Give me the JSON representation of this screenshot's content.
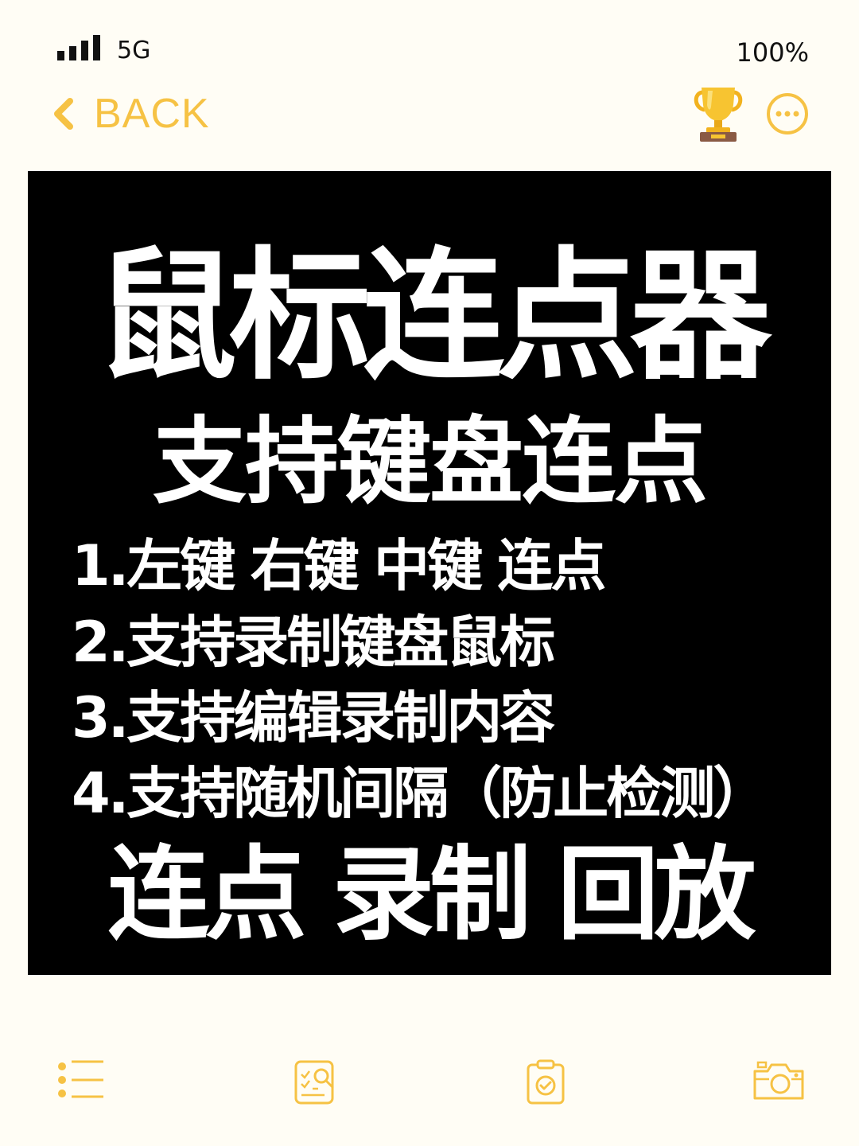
{
  "status_bar": {
    "network": "5G",
    "battery": "100%"
  },
  "nav": {
    "back_label": "BACK"
  },
  "content": {
    "headline": "鼠标连点器",
    "subhead": "支持键盘连点",
    "features": [
      "1.左键 右键 中键 连点",
      "2.支持录制键盘鼠标",
      "3.支持编辑录制内容",
      "4.支持随机间隔（防止检测）"
    ],
    "tagline": "连点 录制 回放"
  },
  "colors": {
    "accent": "#f6c244",
    "background": "#fffdf5",
    "image_background": "#000000",
    "image_text": "#ffffff"
  },
  "icons": {
    "top_right": [
      "trophy-icon",
      "more-icon"
    ],
    "bottom_tabs": [
      "list-icon",
      "notes-icon",
      "clipboard-check-icon",
      "camera-icon"
    ]
  }
}
